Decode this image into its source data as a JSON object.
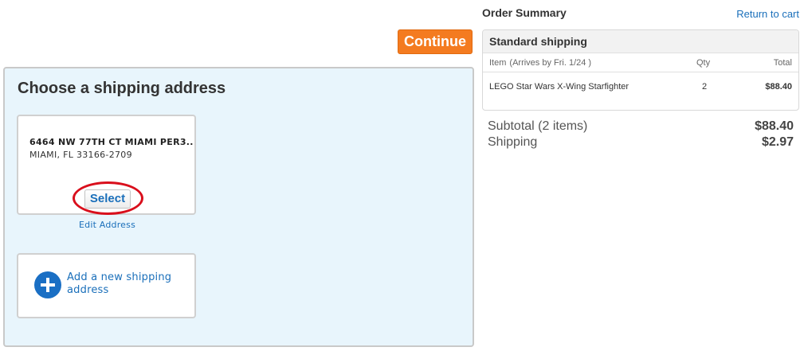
{
  "checkout": {
    "continue_label": "Continue"
  },
  "shipping": {
    "title": "Choose a shipping address",
    "address": {
      "line1": "6464 NW 77TH CT MIAMI PER3...",
      "line2": "MIAMI, FL 33166-2709",
      "select_label": "Select",
      "edit_label": "Edit Address"
    },
    "add_new_label": "Add a new shipping address",
    "highlight_color": "#d90f1c"
  },
  "summary": {
    "title": "Order Summary",
    "return_label": "Return to cart",
    "method": "Standard shipping",
    "columns": {
      "item": "Item",
      "arrives": "(Arrives by Fri. 1/24 )",
      "qty": "Qty",
      "total": "Total"
    },
    "items": [
      {
        "name": "LEGO Star Wars X-Wing Starfighter",
        "qty": "2",
        "total": "$88.40"
      }
    ],
    "subtotal_label": "Subtotal (2 items)",
    "subtotal_value": "$88.40",
    "shipping_label": "Shipping",
    "shipping_value": "$2.97"
  },
  "colors": {
    "accent_orange": "#f47b20",
    "link_blue": "#1a6fba",
    "panel_bg": "#e8f5fc"
  }
}
